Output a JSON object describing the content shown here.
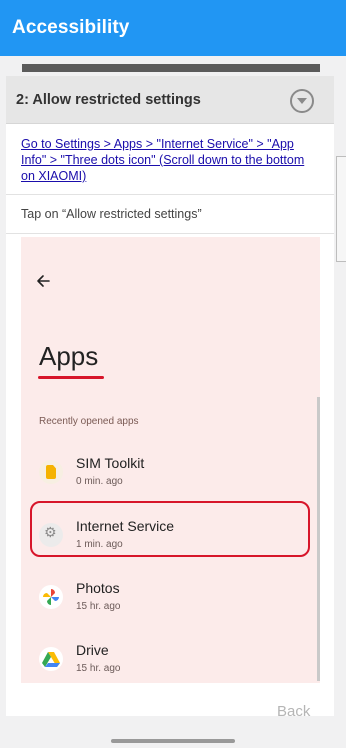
{
  "appbar": {
    "title": "Accessibility"
  },
  "step": {
    "title": "2: Allow restricted settings",
    "link_text": "Go to Settings > Apps > \"Internet Service\" > \"App Info\" > \"Three dots icon\" (Scroll down to the bottom on XIAOMI)",
    "instruction": "Tap on “Allow restricted settings”"
  },
  "phone": {
    "title": "Apps",
    "section_label": "Recently opened apps",
    "apps": [
      {
        "name": "SIM Toolkit",
        "time": "0 min. ago",
        "icon": "sim-toolkit-icon"
      },
      {
        "name": "Internet Service",
        "time": "1 min. ago",
        "icon": "gear-icon"
      },
      {
        "name": "Photos",
        "time": "15 hr. ago",
        "icon": "photos-pinwheel-icon"
      },
      {
        "name": "Drive",
        "time": "15 hr. ago",
        "icon": "drive-triangle-icon"
      }
    ],
    "highlight_color": "#d7152a"
  },
  "footer": {
    "back_label": "Back"
  },
  "colors": {
    "appbar": "#2196f3",
    "link": "#1a0dab",
    "phone_bg": "#fcebea"
  }
}
